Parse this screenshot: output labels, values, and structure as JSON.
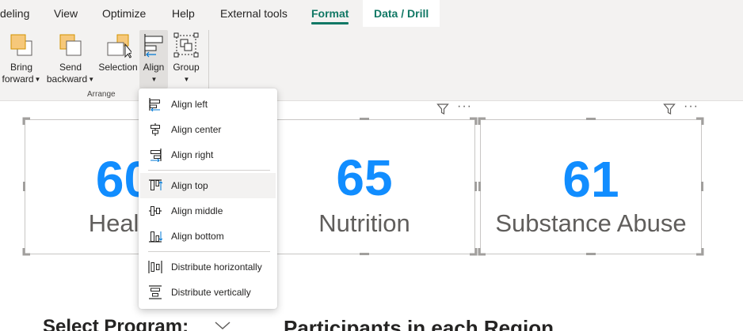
{
  "ribbon": {
    "tabs": [
      {
        "label": "deling",
        "active": false
      },
      {
        "label": "View",
        "active": false
      },
      {
        "label": "Optimize",
        "active": false
      },
      {
        "label": "Help",
        "active": false
      },
      {
        "label": "External tools",
        "active": false
      },
      {
        "label": "Format",
        "active": true
      },
      {
        "label": "Data / Drill",
        "active": false
      }
    ],
    "buttons": {
      "bring_forward": {
        "line1": "Bring",
        "line2": "forward"
      },
      "send_backward": {
        "line1": "Send",
        "line2": "backward"
      },
      "selection": {
        "label": "Selection"
      },
      "align": {
        "label": "Align"
      },
      "group": {
        "label": "Group"
      }
    },
    "group_label": "Arrange",
    "chevron": "⌄"
  },
  "align_menu": {
    "items": [
      {
        "label": "Align left",
        "icon": "align-left-icon"
      },
      {
        "label": "Align center",
        "icon": "align-center-icon"
      },
      {
        "label": "Align right",
        "icon": "align-right-icon"
      },
      {
        "label": "Align top",
        "icon": "align-top-icon"
      },
      {
        "label": "Align middle",
        "icon": "align-middle-icon"
      },
      {
        "label": "Align bottom",
        "icon": "align-bottom-icon"
      },
      {
        "label": "Distribute horizontally",
        "icon": "distribute-horizontally-icon"
      },
      {
        "label": "Distribute vertically",
        "icon": "distribute-vertically-icon"
      }
    ],
    "hovered": "Align top"
  },
  "cards": [
    {
      "value": "60",
      "category": "Health"
    },
    {
      "value": "65",
      "category": "Nutrition"
    },
    {
      "value": "61",
      "category": "Substance Abuse"
    }
  ],
  "visual_header": {
    "filter_icon": "filter-icon",
    "more_icon": "more-options-icon",
    "more_glyph": "···"
  },
  "bottom": {
    "select_program": "Select Program:",
    "region_title": "Participants in each Region"
  },
  "colors": {
    "accent": "#117865",
    "card_value": "#118dff",
    "card_label": "#605e5c",
    "ribbon_bg": "#f3f2f1",
    "menu_icon_blue": "#0078d4"
  }
}
